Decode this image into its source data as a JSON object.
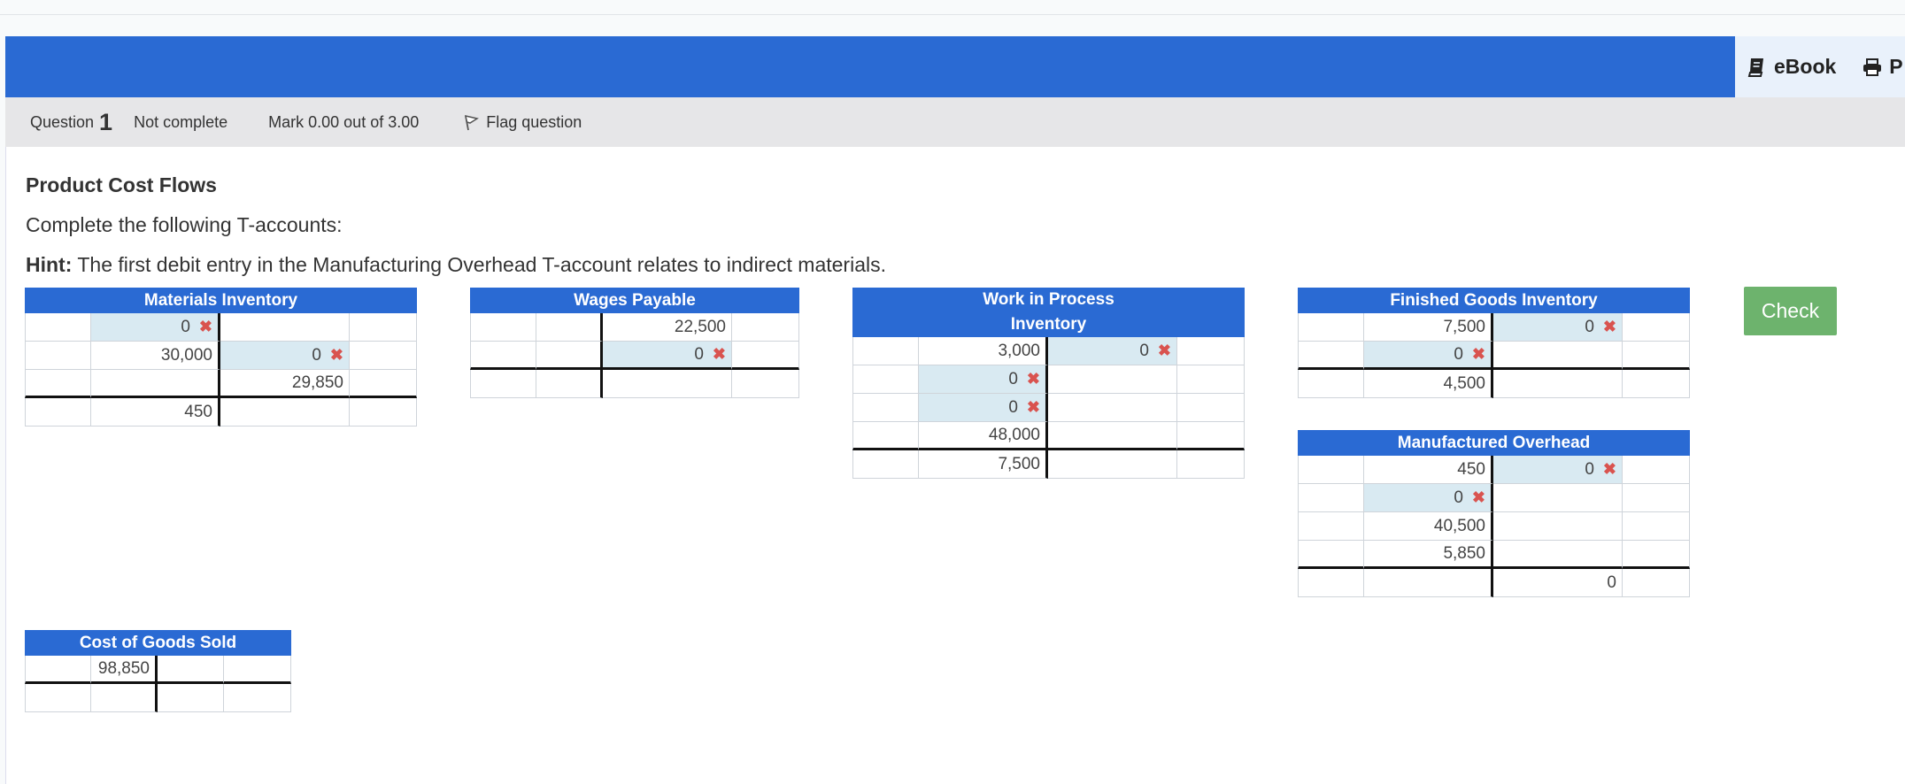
{
  "toolbar": {
    "ebook_label": "eBook",
    "print_label": "P"
  },
  "question": {
    "label": "Question",
    "number": "1",
    "state": "Not complete",
    "mark": "Mark 0.00 out of 3.00",
    "flag": "Flag question"
  },
  "content": {
    "title": "Product Cost Flows",
    "instruction": "Complete the following T-accounts:",
    "hint_label": "Hint:",
    "hint_text": " The first debit entry in the Manufacturing Overhead T-account relates to indirect materials.",
    "check_label": "Check"
  },
  "accounts": {
    "materials": {
      "title": "Materials Inventory",
      "r1_debit": "0",
      "r2_debit": "30,000",
      "r2_credit": "0",
      "r3_credit": "29,850",
      "r4_debit": "450"
    },
    "wages": {
      "title": "Wages Payable",
      "r1_credit": "22,500",
      "r2_credit": "0"
    },
    "wip": {
      "title_line1": "Work in Process",
      "title_line2": "Inventory",
      "r1_debit": "3,000",
      "r1_credit": "0",
      "r2_debit": "0",
      "r3_debit": "0",
      "r4_debit": "48,000",
      "r5_debit": "7,500"
    },
    "fgi": {
      "title": "Finished Goods Inventory",
      "r1_debit": "7,500",
      "r1_credit": "0",
      "r2_debit": "0",
      "r3_debit": "4,500"
    },
    "moh": {
      "title": "Manufactured Overhead",
      "r1_debit": "450",
      "r1_credit": "0",
      "r2_debit": "0",
      "r3_debit": "40,500",
      "r4_debit": "5,850",
      "r5_credit": "0"
    },
    "cogs": {
      "title": "Cost of Goods Sold",
      "r1_debit": "98,850"
    }
  },
  "colors": {
    "header_blue": "#2a6ad3",
    "input_fill": "#d9eaf2",
    "error_red": "#d9534f",
    "check_green": "#6db36d"
  },
  "icons": {
    "ebook": "book-icon",
    "print": "printer-icon",
    "flag": "flag-icon",
    "wrong": "x-mark-icon"
  }
}
